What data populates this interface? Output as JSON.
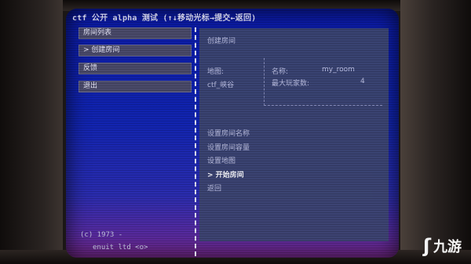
{
  "window": {
    "title": "ctf 公开 alpha 测试 (↑↓移动光标→提交←返回)"
  },
  "sidebar": {
    "items": [
      {
        "label": "房间列表"
      },
      {
        "label": "> 创建房间"
      },
      {
        "label": "反馈"
      },
      {
        "label": "退出"
      }
    ],
    "footer_line1": "(c) 1973 -",
    "footer_line2": "enuit ltd <o>"
  },
  "panel": {
    "heading": "创建房间",
    "map_label": "地图:",
    "map_value": "ctf_峡谷",
    "name_label": "名称:",
    "name_value": "my_room",
    "max_players_label": "最大玩家数:",
    "max_players_value": "4",
    "options": [
      {
        "label": "设置房间名称"
      },
      {
        "label": "设置房间容量"
      },
      {
        "label": "设置地图"
      },
      {
        "label": "> 开始房间"
      },
      {
        "label": "返回"
      }
    ]
  },
  "watermark": {
    "text": "九游",
    "icon": "swirl-logo-icon"
  },
  "colors": {
    "screen_blue": "#1124b0",
    "panel": "#3c4570",
    "menu_item": "#4a4a6a",
    "text": "#c4c7e6",
    "highlight": "#ffffff"
  }
}
